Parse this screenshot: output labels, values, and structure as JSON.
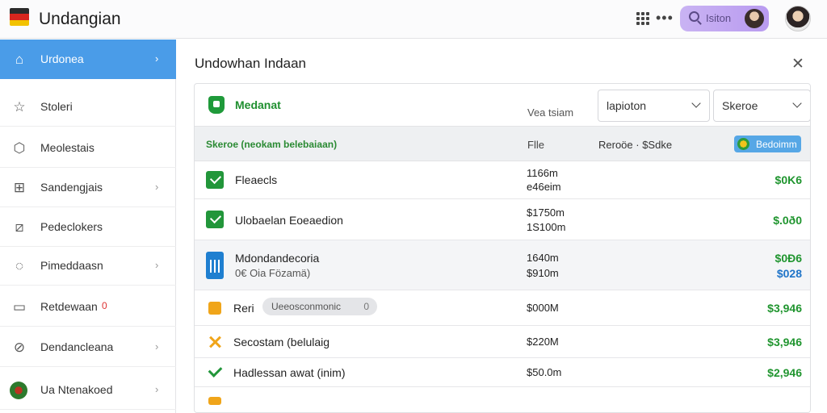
{
  "app": {
    "title": "Undangian"
  },
  "topbar": {
    "search_label": "Isiton"
  },
  "sidebar": {
    "items": [
      {
        "label": "Urdonea"
      },
      {
        "label": "Stoleri"
      },
      {
        "label": "Meolestais"
      },
      {
        "label": "Sandengjais"
      },
      {
        "label": "Pedeclokers"
      },
      {
        "label": "Pimeddaasn"
      },
      {
        "label": "Retdewaan",
        "badge": "0"
      },
      {
        "label": "Dendancleana"
      },
      {
        "label": "Ua Ntenakoed"
      }
    ]
  },
  "panel": {
    "title": "Undowhan Indaan",
    "card": {
      "title": "Medanat",
      "label": "Vea tsiam",
      "select1": "lapioton",
      "select2": "Skeroe"
    },
    "subheader": {
      "col1": "Skeroe (neokam belebaiaan)",
      "col2": "Flle",
      "col3": "Reroöe · $Sdke",
      "badge": "Bedoimm"
    },
    "rows": [
      {
        "name": "Fleaecls",
        "v1": "1166m",
        "v2": "e46eim",
        "amount": "$0K6"
      },
      {
        "name": "Ulobaelan Eoeaedion",
        "v1": "$1750m",
        "v2": "1S100m",
        "amount": "$.0ð0"
      },
      {
        "name": "Mdondandecoria",
        "sub": "0€ Oia Fözamä)",
        "v1": "1640m",
        "v2": "$910m",
        "amount": "$0Ð6",
        "amount2": "$028"
      },
      {
        "name": "Reri",
        "tag": "Ueeosconmonic",
        "tag_num": "0",
        "v1": "$000M",
        "amount": "$3,946"
      },
      {
        "name": "Secostam (belulaig",
        "v1": "$220M",
        "amount": "$3,946"
      },
      {
        "name": "Hadlessan awat (inim)",
        "v1": "$50.0m",
        "amount": "$2,946"
      }
    ]
  }
}
